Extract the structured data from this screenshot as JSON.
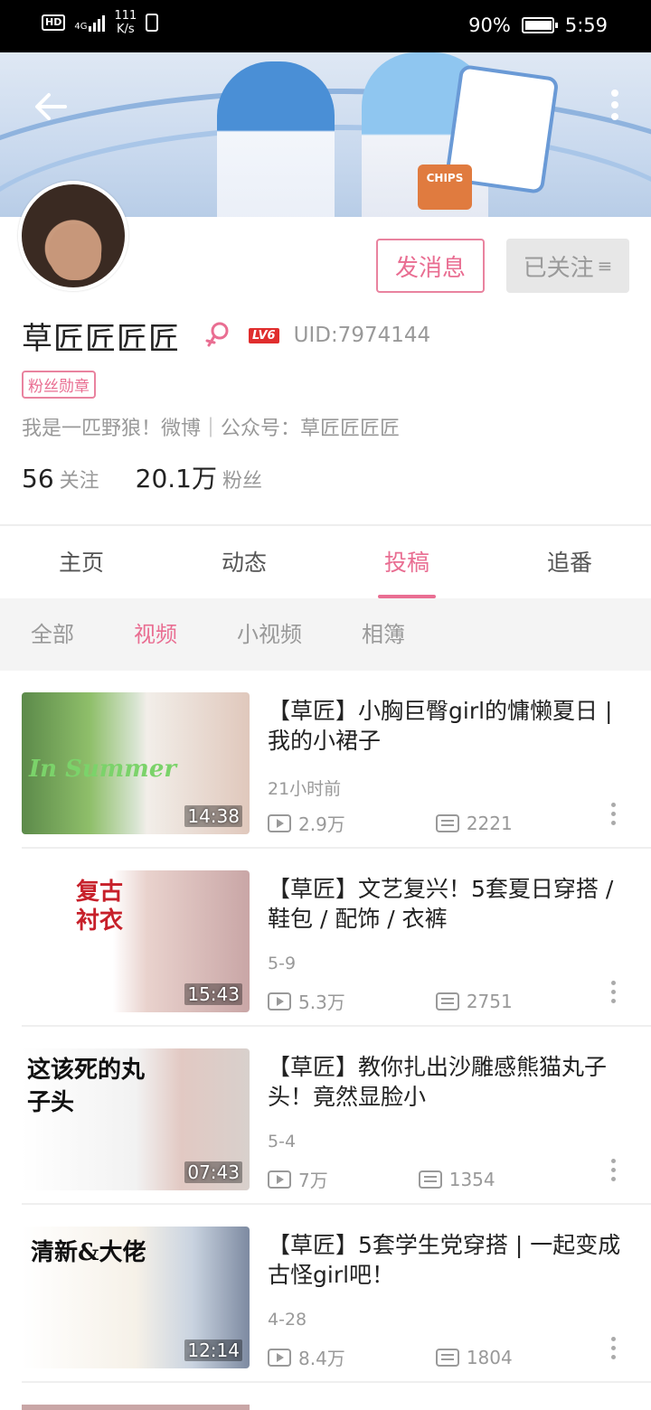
{
  "status_bar": {
    "hd": "HD",
    "net": "4G",
    "speed_value": "111",
    "speed_unit": "K/s",
    "battery": "90%",
    "time": "5:59"
  },
  "banner": {
    "chips_text": "CHIPS"
  },
  "profile": {
    "name": "草匠匠匠匠",
    "level": "LV6",
    "uid": "UID:7974144",
    "medal": "粉丝勋章",
    "bio": "我是一匹野狼！微博｜公众号：草匠匠匠匠",
    "following_count": "56",
    "following_label": "关注",
    "fans_count": "20.1万",
    "fans_label": "粉丝"
  },
  "actions": {
    "message": "发消息",
    "followed": "已关注",
    "followed_menu_glyph": "≡"
  },
  "tabs": [
    "主页",
    "动态",
    "投稿",
    "追番"
  ],
  "active_tab": "投稿",
  "subtabs": [
    "全部",
    "视频",
    "小视频",
    "相簿"
  ],
  "active_subtab": "视频",
  "videos": [
    {
      "title": "【草匠】小胸巨臀girl的慵懒夏日 | 我的小裙子",
      "time": "21小时前",
      "views": "2.9万",
      "danmaku": "2221",
      "duration": "14:38",
      "thumb_text": "In Summer"
    },
    {
      "title": "【草匠】文艺复兴！5套夏日穿搭 / 鞋包 / 配饰 / 衣裤",
      "time": "5-9",
      "views": "5.3万",
      "danmaku": "2751",
      "duration": "15:43",
      "thumb_text": "复古衬衣"
    },
    {
      "title": "【草匠】教你扎出沙雕感熊猫丸子头！竟然显脸小",
      "time": "5-4",
      "views": "7万",
      "danmaku": "1354",
      "duration": "07:43",
      "thumb_text": "这该死的丸子头"
    },
    {
      "title": "【草匠】5套学生党穿搭 | 一起变成古怪girl吧！",
      "time": "4-28",
      "views": "8.4万",
      "danmaku": "1804",
      "duration": "12:14",
      "thumb_text": "清新&大佬"
    }
  ],
  "colors": {
    "accent": "#e96e92",
    "banner": "#c9d9ee",
    "status_bar": "#000000"
  }
}
